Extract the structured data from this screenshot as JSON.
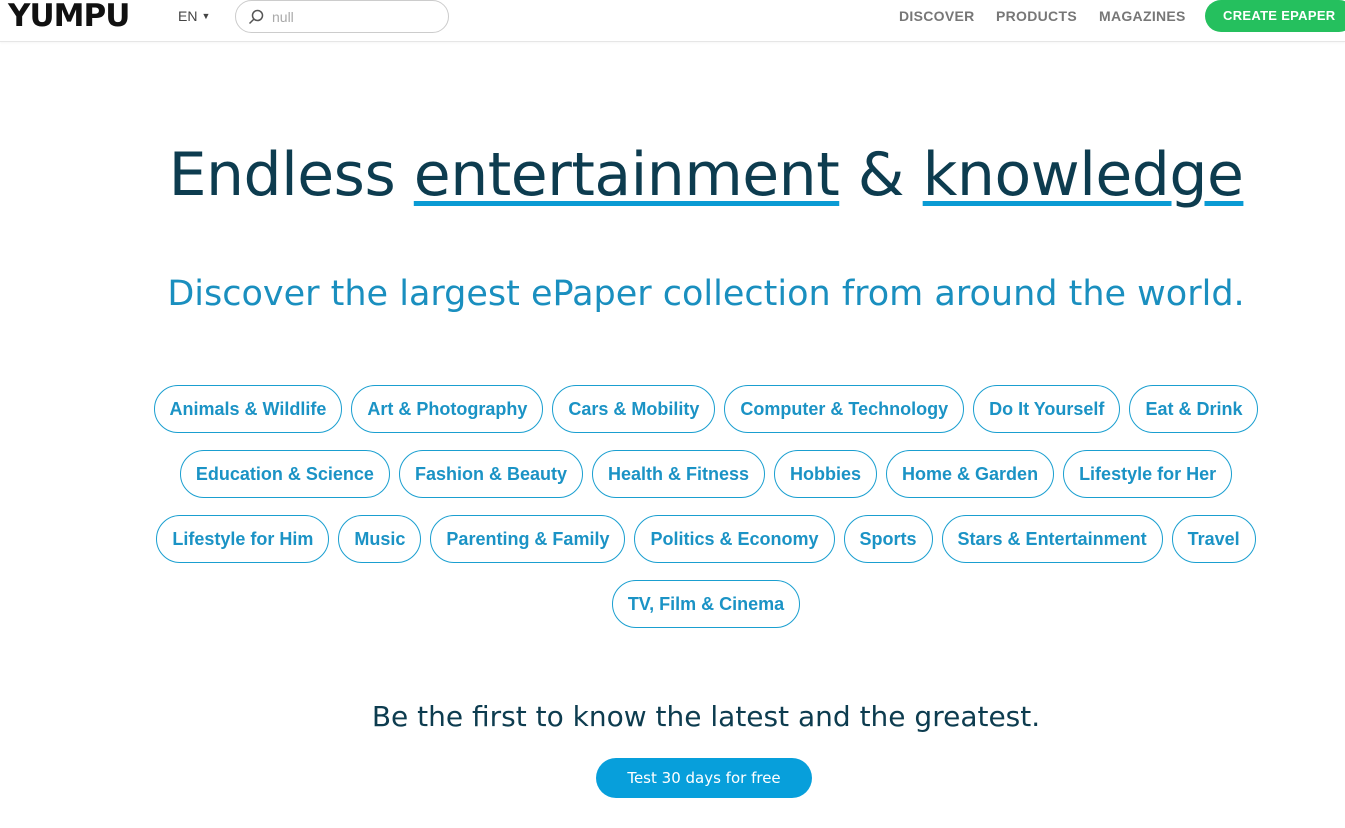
{
  "nav": {
    "logo": "YUMPU",
    "language": "EN",
    "search_placeholder": "null",
    "menu": [
      "DISCOVER",
      "PRODUCTS",
      "MAGAZINES"
    ],
    "cta": "CREATE EPAPER",
    "cta_color": "#25c05e"
  },
  "hero": {
    "title_part1": "Endless ",
    "title_link1": "entertainment",
    "title_part2": " & ",
    "title_link2": "knowledge",
    "subtitle": "Discover the largest ePaper collection from around the world."
  },
  "categories": {
    "rows": [
      [
        "Animals & Wildlife",
        "Art & Photography",
        "Cars & Mobility",
        "Computer & Technology",
        "Do It Yourself",
        "Eat & Drink"
      ],
      [
        "Education & Science",
        "Fashion & Beauty",
        "Health & Fitness",
        "Hobbies",
        "Home & Garden",
        "Lifestyle for Her"
      ],
      [
        "Lifestyle for Him",
        "Music",
        "Parenting & Family",
        "Politics & Economy",
        "Sports",
        "Stars & Entertainment",
        "Travel"
      ],
      [
        "TV, Film & Cinema"
      ]
    ]
  },
  "signup": {
    "tagline": "Be the first to know the latest and the greatest.",
    "button": "Test 30 days for free",
    "button_color": "#079fdb"
  }
}
